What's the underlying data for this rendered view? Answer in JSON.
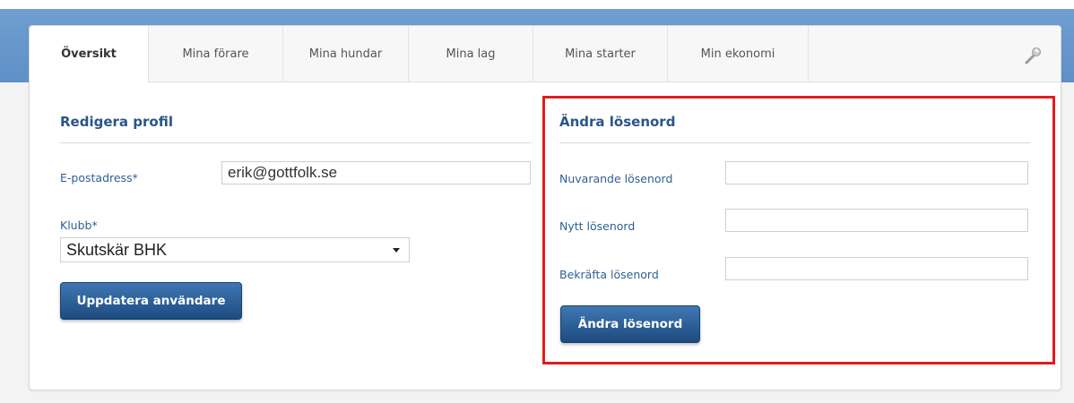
{
  "tabs": [
    {
      "label": "Översikt",
      "active": true
    },
    {
      "label": "Mina förare",
      "active": false
    },
    {
      "label": "Mina hundar",
      "active": false
    },
    {
      "label": "Mina lag",
      "active": false
    },
    {
      "label": "Mina starter",
      "active": false
    },
    {
      "label": "Min ekonomi",
      "active": false
    }
  ],
  "toolbar": {
    "settings_icon": "wrench-icon"
  },
  "profile": {
    "title": "Redigera profil",
    "email_label": "E-postadress*",
    "email_value": "erik@gottfolk.se",
    "club_label": "Klubb*",
    "club_value": "Skutskär BHK",
    "submit_label": "Uppdatera användare"
  },
  "password": {
    "title": "Ändra lösenord",
    "current_label": "Nuvarande lösenord",
    "new_label": "Nytt lösenord",
    "confirm_label": "Bekräfta lösenord",
    "submit_label": "Ändra lösenord"
  },
  "colors": {
    "accent": "#2b5587",
    "button": "#2a5a91",
    "highlight": "#e01d1d",
    "band": "#6a98cc"
  }
}
